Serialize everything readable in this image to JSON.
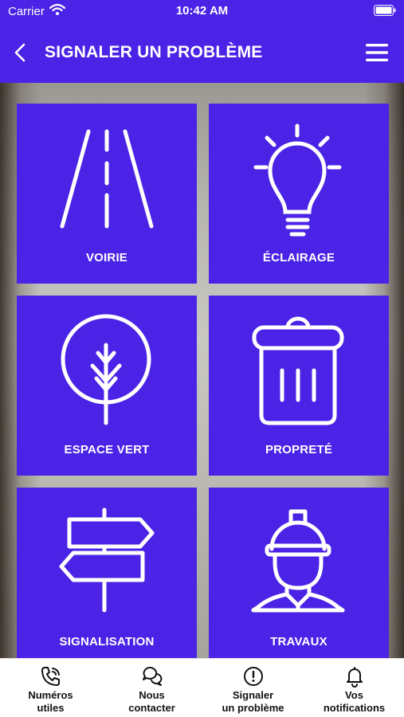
{
  "status_bar": {
    "carrier": "Carrier",
    "time": "10:42 AM"
  },
  "header": {
    "title": "SIGNALER UN PROBLÈME",
    "back_icon": "chevron-left-icon",
    "menu_icon": "hamburger-menu-icon"
  },
  "colors": {
    "primary": "#4a23e6",
    "tile_text": "#ffffff",
    "tab_text": "#111111"
  },
  "tiles": [
    {
      "label": "VOIRIE",
      "icon": "road-icon"
    },
    {
      "label": "ÉCLAIRAGE",
      "icon": "lightbulb-icon"
    },
    {
      "label": "ESPACE VERT",
      "icon": "tree-icon"
    },
    {
      "label": "PROPRETÉ",
      "icon": "trash-bin-icon"
    },
    {
      "label": "SIGNALISATION",
      "icon": "signpost-icon"
    },
    {
      "label": "TRAVAUX",
      "icon": "construction-worker-icon"
    }
  ],
  "tab_bar": {
    "items": [
      {
        "line1": "Numéros",
        "line2": "utiles",
        "icon": "phone-icon"
      },
      {
        "line1": "Nous",
        "line2": "contacter",
        "icon": "chat-bubbles-icon"
      },
      {
        "line1": "Signaler",
        "line2": "un problème",
        "icon": "alert-circle-icon"
      },
      {
        "line1": "Vos",
        "line2": "notifications",
        "icon": "bell-icon"
      }
    ]
  }
}
